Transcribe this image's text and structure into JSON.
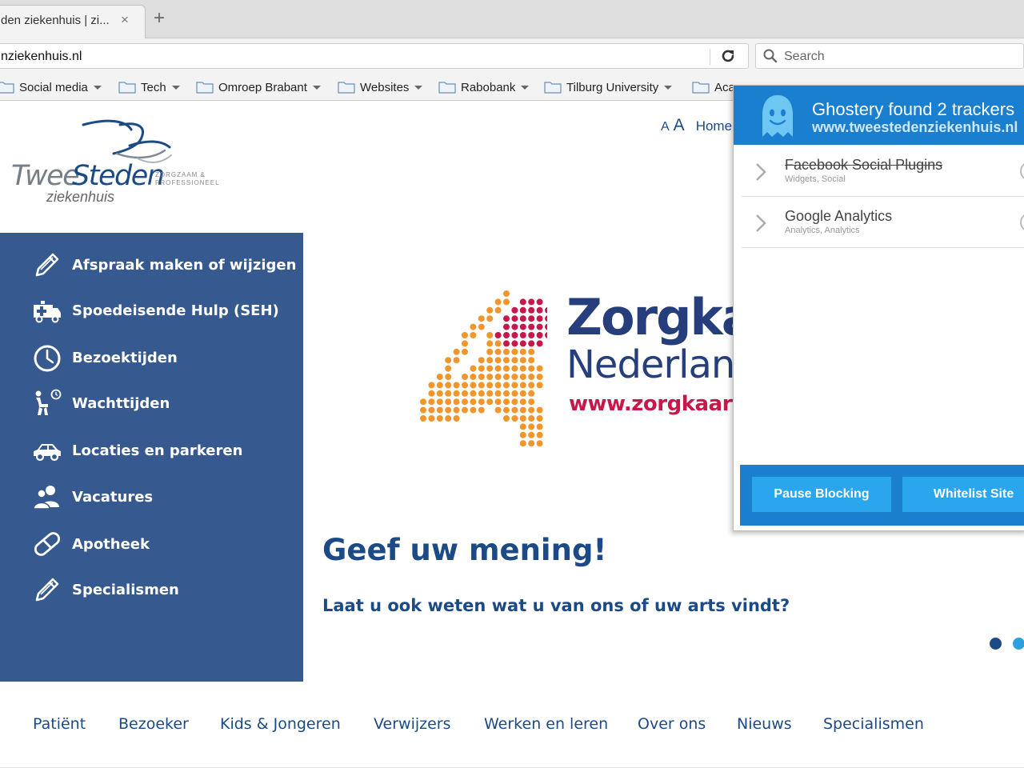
{
  "browser": {
    "tab": {
      "title": "den ziekenhuis | zi...",
      "close_glyph": "×"
    },
    "newtab_glyph": "+",
    "url": "nziekenhuis.nl",
    "search_placeholder": "Search",
    "bookmarks": [
      {
        "label": "Social media"
      },
      {
        "label": "Tech"
      },
      {
        "label": "Omroep Brabant"
      },
      {
        "label": "Websites"
      },
      {
        "label": "Rabobank"
      },
      {
        "label": "Tilburg University"
      },
      {
        "label": "Aca"
      }
    ]
  },
  "header": {
    "logo": {
      "twee": "Twee",
      "steden": "Steden",
      "tagline_1": "ZORGZAAM &",
      "tagline_2": "PROFESSIONEEL",
      "sub": "ziekenhuis"
    },
    "font_small": "A",
    "font_large": "A",
    "home": "Home"
  },
  "sidebar": {
    "items": [
      {
        "label": "Afspraak maken of wijzigen",
        "icon": "pencil-icon"
      },
      {
        "label": "Spoedeisende Hulp (SEH)",
        "icon": "ambulance-icon"
      },
      {
        "label": "Bezoektijden",
        "icon": "clock-icon"
      },
      {
        "label": "Wachttijden",
        "icon": "waiting-person-icon"
      },
      {
        "label": "Locaties en parkeren",
        "icon": "car-icon"
      },
      {
        "label": "Vacatures",
        "icon": "people-icon"
      },
      {
        "label": "Apotheek",
        "icon": "pill-icon"
      },
      {
        "label": "Specialismen",
        "icon": "pencil-icon"
      }
    ]
  },
  "banner": {
    "brand_title": "Zorgka",
    "brand_sub": "Nederlan",
    "brand_url": "www.zorgkaartn",
    "headline": "Geef uw mening!",
    "subline": "Laat u ook weten wat u van ons of uw arts vindt?"
  },
  "bottom_nav": [
    "Patiënt",
    "Bezoeker",
    "Kids & Jongeren",
    "Verwijzers",
    "Werken en leren",
    "Over ons",
    "Nieuws",
    "Specialismen"
  ],
  "ghostery": {
    "title": "Ghostery found 2 trackers",
    "site": "www.tweestedenziekenhuis.nl",
    "trackers": [
      {
        "name": "Facebook Social Plugins",
        "category": "Widgets, Social",
        "blocked": true
      },
      {
        "name": "Google Analytics",
        "category": "Analytics, Analytics",
        "blocked": false
      }
    ],
    "pause_button": "Pause Blocking",
    "whitelist_button": "Whitelist Site"
  },
  "colors": {
    "sidebar_bg": "#36598f",
    "brand_blue": "#1c4a86",
    "ghostery_blue": "#1b7fd0",
    "zorgkaart_orange": "#f0962c",
    "zorgkaart_red": "#c8174a"
  }
}
